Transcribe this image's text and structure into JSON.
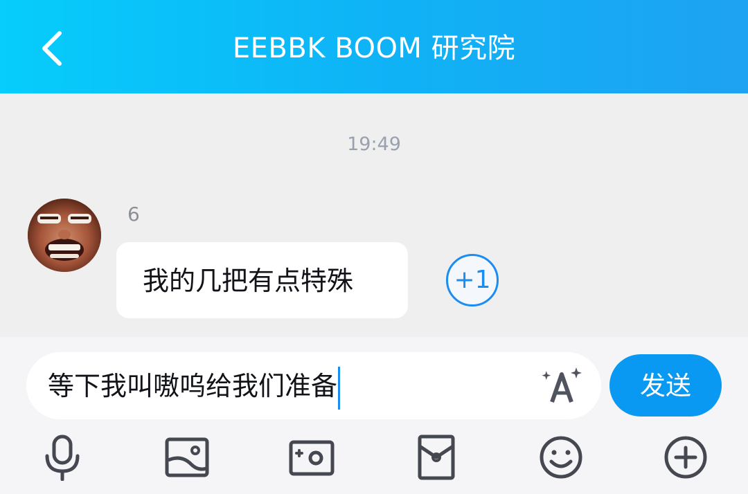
{
  "header": {
    "title": "EEBBK BOOM 研究院",
    "back_icon": "chevron-left-icon"
  },
  "chat": {
    "timestamp": "19:49",
    "messages": [
      {
        "sender": "6",
        "text": "我的几把有点特殊",
        "plus_one": "+1"
      }
    ]
  },
  "composer": {
    "input_value": "等下我叫嗷呜给我们准备",
    "font_icon": "font-style-icon",
    "send_label": "发送"
  },
  "toolbar": {
    "items": [
      "microphone-icon",
      "image-icon",
      "camera-icon",
      "red-packet-icon",
      "emoji-icon",
      "plus-icon"
    ]
  },
  "colors": {
    "header_gradient_start": "#06cdfb",
    "header_gradient_end": "#1ea2f2",
    "accent": "#0a99f2",
    "background": "#efefef"
  }
}
